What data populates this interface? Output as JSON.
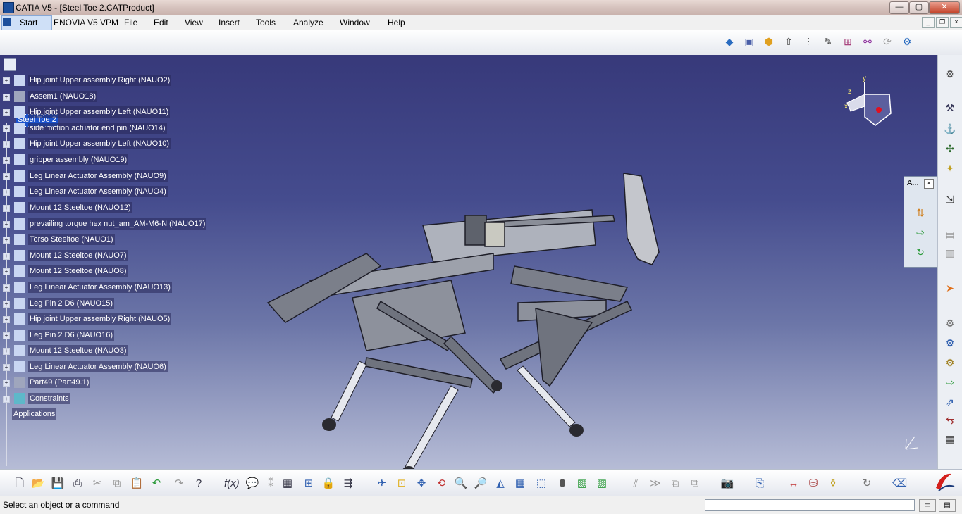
{
  "window": {
    "title": "CATIA V5 - [Steel Toe 2.CATProduct]"
  },
  "menu": [
    "Start",
    "ENOVIA V5 VPM",
    "File",
    "Edit",
    "View",
    "Insert",
    "Tools",
    "Analyze",
    "Window",
    "Help"
  ],
  "tree": {
    "root": "Steel Toe 2",
    "items": [
      "Hip joint Upper assembly Right  (NAUO2)",
      "Assem1 (NAUO18)",
      "Hip joint Upper assembly Left  (NAUO11)",
      "side motion actuator end pin (NAUO14)",
      "Hip joint Upper assembly Left  (NAUO10)",
      "gripper assembly (NAUO19)",
      "Leg Linear Actuator Assembly (NAUO9)",
      "Leg Linear Actuator Assembly (NAUO4)",
      "Mount 12 Steeltoe (NAUO12)",
      "prevailing torque hex nut_am_AM-M6-N (NAUO17)",
      "Torso Steeltoe (NAUO1)",
      "Mount 12 Steeltoe (NAUO7)",
      "Mount 12 Steeltoe (NAUO8)",
      "Leg Linear Actuator Assembly (NAUO13)",
      "Leg Pin 2 D6 (NAUO15)",
      "Hip joint Upper assembly Right  (NAUO5)",
      "Leg Pin 2 D6 (NAUO16)",
      "Mount 12 Steeltoe (NAUO3)",
      "Leg Linear Actuator Assembly (NAUO6)",
      "Part49 (Part49.1)",
      "Constraints"
    ],
    "applications": "Applications"
  },
  "floating_toolbar": {
    "title": "A..."
  },
  "compass": {
    "x": "x",
    "y": "y",
    "z": "z"
  },
  "status": {
    "message": "Select an object or a command"
  },
  "colors": {
    "viewport_top": "#37397a",
    "viewport_bottom": "#b6bcd6",
    "selection": "#1a52cc",
    "close_button": "#c24127"
  }
}
